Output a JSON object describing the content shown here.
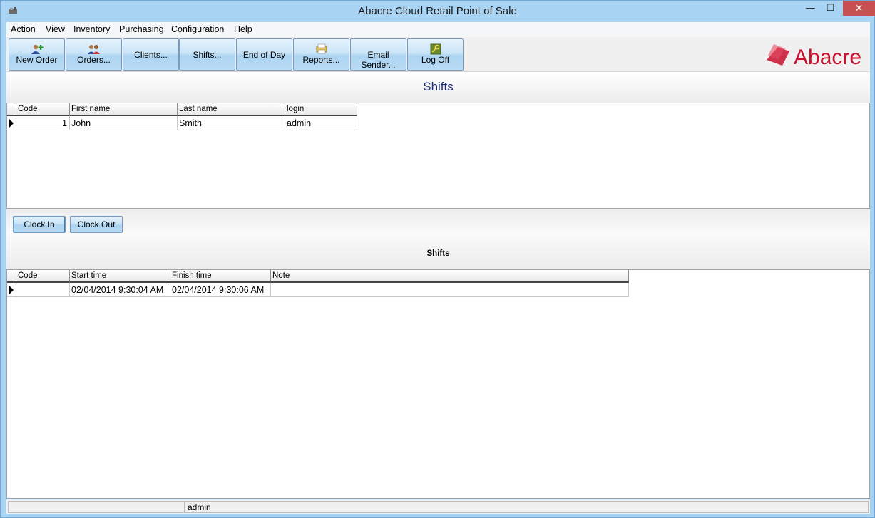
{
  "window": {
    "title": "Abacre Cloud Retail Point of Sale",
    "minimize_glyph": "—",
    "maximize_glyph": "☐",
    "close_glyph": "✕"
  },
  "menu": [
    "Action",
    "View",
    "Inventory",
    "Purchasing",
    "Configuration",
    "Help"
  ],
  "toolbar": {
    "buttons": [
      {
        "label": "New Order",
        "icon": "new-order-icon"
      },
      {
        "label": "Orders...",
        "icon": "orders-icon"
      },
      {
        "label": "Clients...",
        "icon": ""
      },
      {
        "label": "Shifts...",
        "icon": ""
      },
      {
        "label": "End of Day",
        "icon": ""
      },
      {
        "label": "Reports...",
        "icon": "reports-icon"
      },
      {
        "label": "Email Sender...",
        "icon": ""
      },
      {
        "label": "Log Off",
        "icon": "key-icon"
      }
    ],
    "logo_text": "Abacre",
    "logo_color": "#c8102e"
  },
  "header": {
    "title": "Shifts"
  },
  "users_grid": {
    "columns": [
      "Code",
      "First name",
      "Last name",
      "login"
    ],
    "rows": [
      {
        "code": "1",
        "first_name": "John",
        "last_name": "Smith",
        "login": "admin"
      }
    ]
  },
  "actions": {
    "clock_in": "Clock In",
    "clock_out": "Clock Out"
  },
  "shifts_section": {
    "title": "Shifts"
  },
  "shifts_grid": {
    "columns": [
      "Code",
      "Start time",
      "Finish time",
      "Note"
    ],
    "rows": [
      {
        "code": "",
        "start_time": "02/04/2014 9:30:04 AM",
        "finish_time": "02/04/2014 9:30:06 AM",
        "note": ""
      }
    ]
  },
  "status": {
    "user": "admin"
  }
}
